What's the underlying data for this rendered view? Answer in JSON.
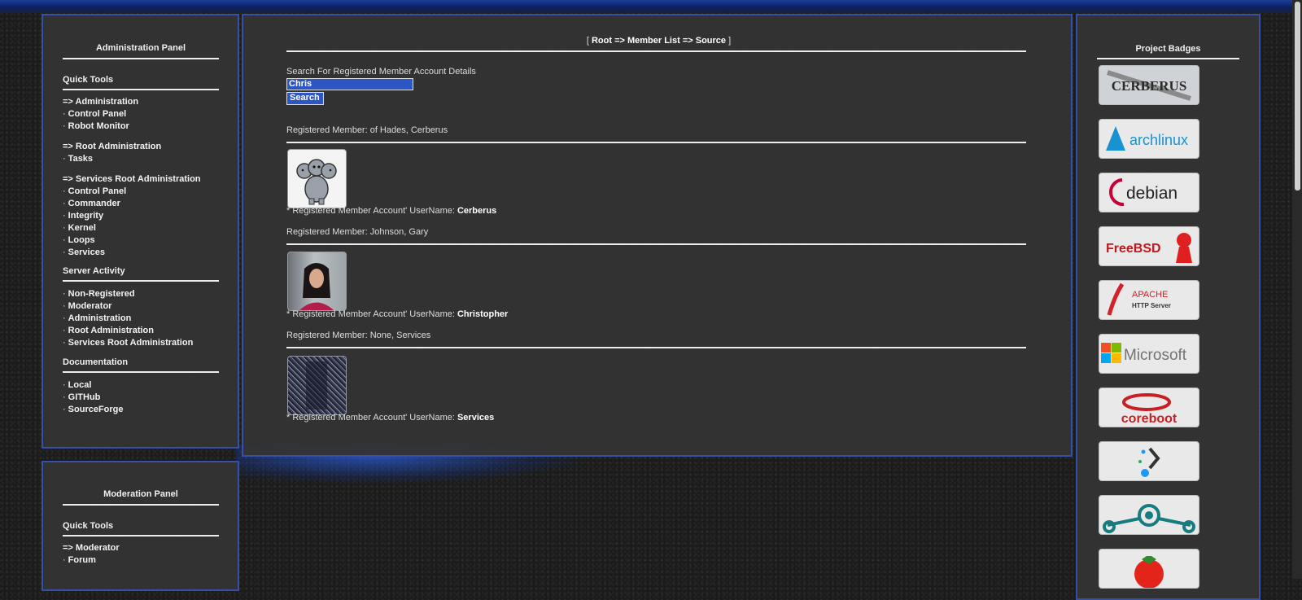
{
  "admin": {
    "title": "Administration Panel",
    "quick_tools": "Quick Tools",
    "groups": [
      {
        "items": [
          "=> Administration",
          "Control Panel",
          "Robot Monitor"
        ]
      },
      {
        "items": [
          "=> Root Administration",
          "Tasks"
        ]
      },
      {
        "items": [
          "=> Services Root Administration",
          "Control Panel",
          "Commander",
          "Integrity",
          "Kernel",
          "Loops",
          "Services"
        ]
      }
    ],
    "server_activity": "Server Activity",
    "activity_items": [
      "Non-Registered",
      "Moderator",
      "Administration",
      "Root Administration",
      "Services Root Administration"
    ],
    "documentation": "Documentation",
    "doc_items": [
      "Local",
      "GITHub",
      "SourceForge"
    ]
  },
  "moderation": {
    "title": "Moderation Panel",
    "quick_tools": "Quick Tools",
    "items": [
      "=> Moderator",
      "Forum"
    ]
  },
  "main": {
    "breadcrumb_open": "[",
    "breadcrumb_text": "Root => Member List => Source",
    "breadcrumb_close": "]",
    "search_label": "Search For Registered Member Account Details",
    "search_value": "Chris",
    "search_button": "Search",
    "username_prefix": "* Registered Member Account' UserName:",
    "members": [
      {
        "heading": "Registered Member: of Hades, Cerberus",
        "username": "Cerberus"
      },
      {
        "heading": "Registered Member: Johnson, Gary",
        "username": "Christopher"
      },
      {
        "heading": "Registered Member: None, Services",
        "username": "Services"
      }
    ]
  },
  "badges": {
    "title": "Project Badges",
    "items": [
      {
        "name": "cerberus-badge",
        "text": "CERBERUS"
      },
      {
        "name": "archlinux-badge",
        "text": "archlinux"
      },
      {
        "name": "debian-badge",
        "text": "debian"
      },
      {
        "name": "freebsd-badge",
        "text": "FreeBSD"
      },
      {
        "name": "apache-badge",
        "text": "APACHE",
        "subtext": "HTTP Server"
      },
      {
        "name": "microsoft-badge",
        "text": "Microsoft"
      },
      {
        "name": "coreboot-badge",
        "text": "coreboot"
      },
      {
        "name": "kdeconnect-badge",
        "text": ""
      },
      {
        "name": "lineageos-badge",
        "text": ""
      },
      {
        "name": "tomato-badge",
        "text": ""
      }
    ]
  },
  "colors": {
    "border": "#3450a8",
    "accent": "#2d55c4",
    "panel": "#343434"
  }
}
